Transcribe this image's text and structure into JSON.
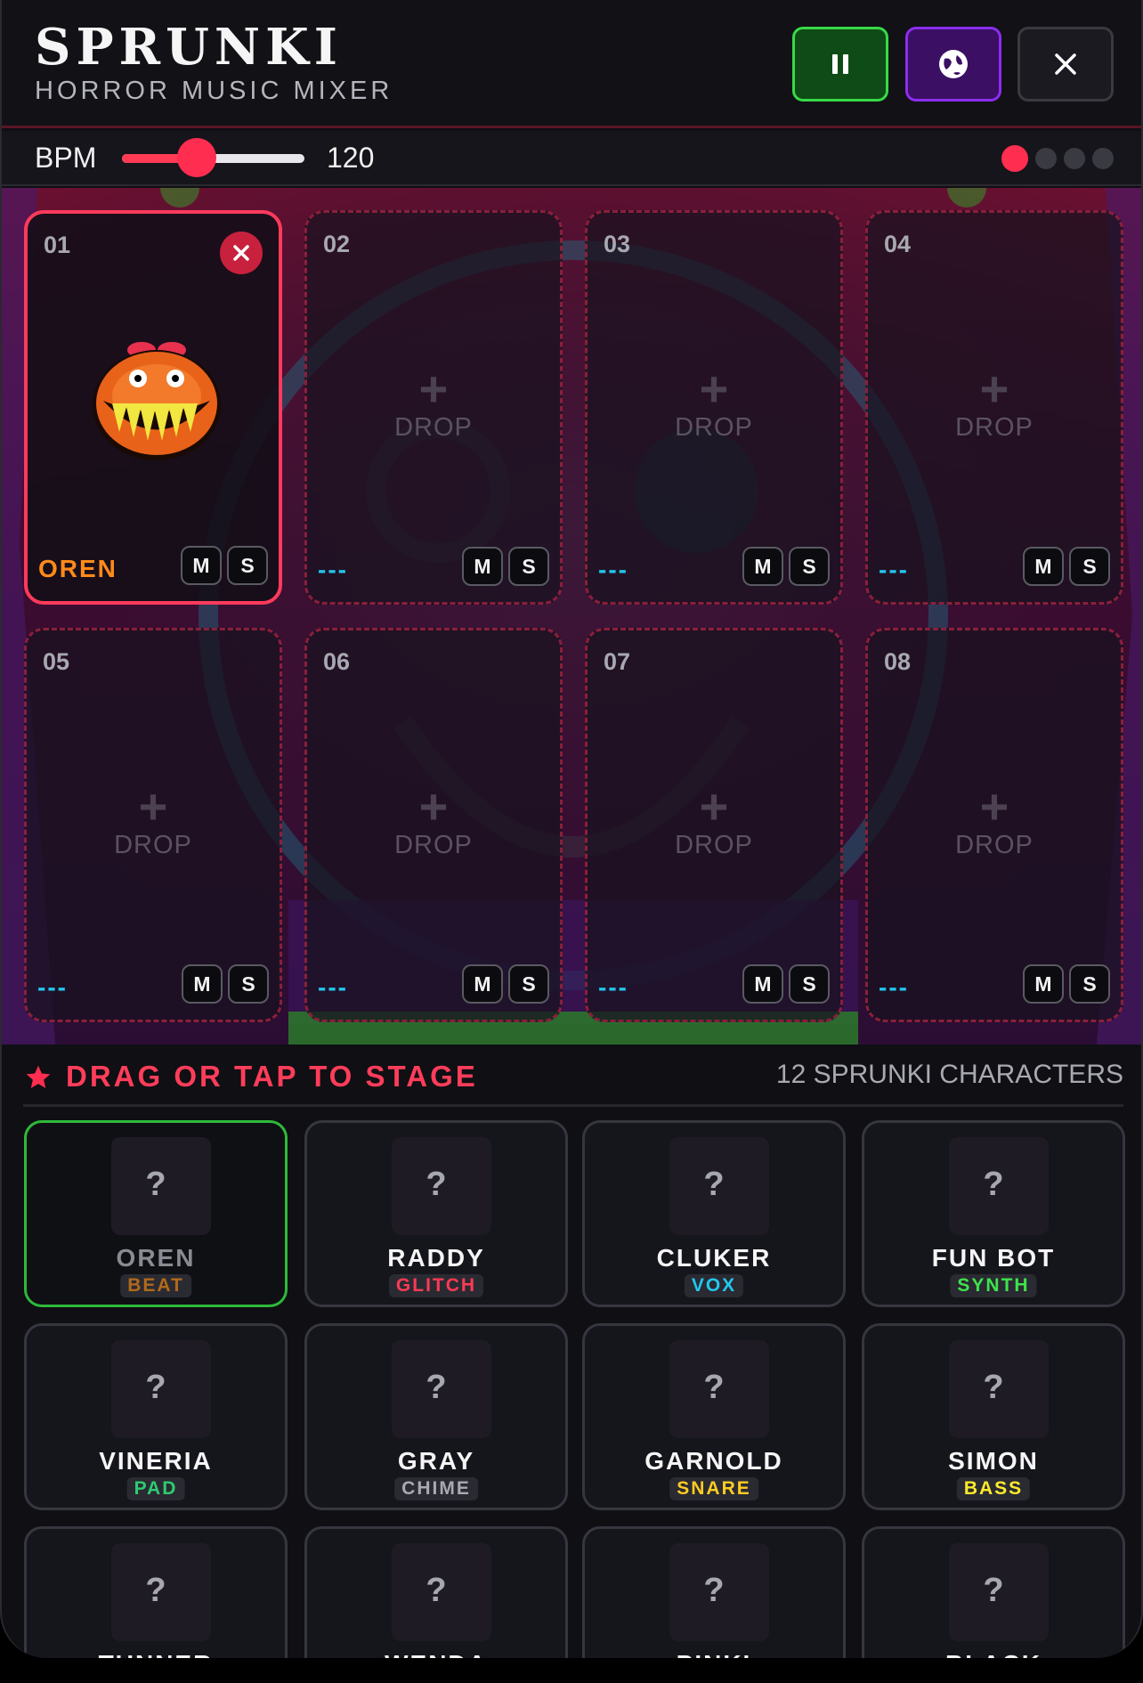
{
  "header": {
    "title": "SPRUNKI",
    "subtitle": "HORROR MUSIC MIXER",
    "buttons": {
      "pause": "pause-icon",
      "globe": "globe-icon",
      "close": "close-icon"
    }
  },
  "bpm": {
    "label": "BPM",
    "value": "120",
    "slider_fraction": 0.41
  },
  "pages": {
    "count": 4,
    "active": 1
  },
  "stage": {
    "slots": [
      {
        "num": "01",
        "name": "OREN",
        "filled": true
      },
      {
        "num": "02",
        "name": "---",
        "filled": false
      },
      {
        "num": "03",
        "name": "---",
        "filled": false
      },
      {
        "num": "04",
        "name": "---",
        "filled": false
      },
      {
        "num": "05",
        "name": "---",
        "filled": false
      },
      {
        "num": "06",
        "name": "---",
        "filled": false
      },
      {
        "num": "07",
        "name": "---",
        "filled": false
      },
      {
        "num": "08",
        "name": "---",
        "filled": false
      }
    ],
    "drop_label": "DROP",
    "mute_label": "M",
    "solo_label": "S"
  },
  "library": {
    "title": "DRAG OR TAP TO STAGE",
    "count": "12 SPRUNKI CHARACTERS",
    "placeholder": "?",
    "cards": [
      {
        "name": "OREN",
        "tag": "BEAT",
        "tag_color": "#b06a1a",
        "active": true
      },
      {
        "name": "RADDY",
        "tag": "GLITCH",
        "tag_color": "#ff3a55"
      },
      {
        "name": "CLUKER",
        "tag": "VOX",
        "tag_color": "#22c7ee"
      },
      {
        "name": "FUN BOT",
        "tag": "SYNTH",
        "tag_color": "#3ee34c"
      },
      {
        "name": "VINERIA",
        "tag": "PAD",
        "tag_color": "#2ecc71"
      },
      {
        "name": "GRAY",
        "tag": "CHIME",
        "tag_color": "#a9a9b2"
      },
      {
        "name": "GARNOLD",
        "tag": "SNARE",
        "tag_color": "#ffcc22"
      },
      {
        "name": "SIMON",
        "tag": "BASS",
        "tag_color": "#ffea2a"
      },
      {
        "name": "TUNNER",
        "tag": "",
        "tag_color": "#a9a9b2"
      },
      {
        "name": "WENDA",
        "tag": "",
        "tag_color": "#a9a9b2"
      },
      {
        "name": "PINKI",
        "tag": "",
        "tag_color": "#a9a9b2"
      },
      {
        "name": "BLACK",
        "tag": "",
        "tag_color": "#a9a9b2"
      }
    ]
  }
}
